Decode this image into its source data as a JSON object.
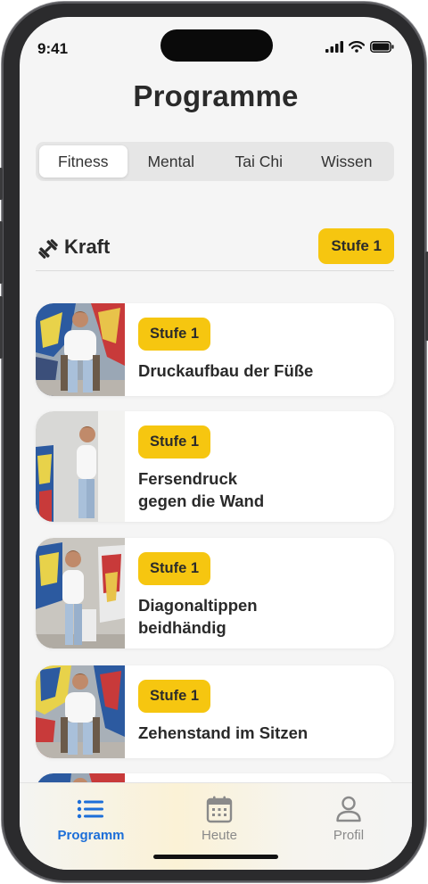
{
  "status_bar": {
    "time": "9:41"
  },
  "header": {
    "title": "Programme"
  },
  "tabs": [
    {
      "label": "Fitness",
      "active": true
    },
    {
      "label": "Mental",
      "active": false
    },
    {
      "label": "Tai Chi",
      "active": false
    },
    {
      "label": "Wissen",
      "active": false
    }
  ],
  "section": {
    "title": "Kraft",
    "icon": "dumbbell-icon",
    "level": "Stufe 1"
  },
  "exercises": [
    {
      "level": "Stufe 1",
      "title": "Druckaufbau der Füße"
    },
    {
      "level": "Stufe 1",
      "title": "Fersendruck\ngegen die Wand"
    },
    {
      "level": "Stufe 1",
      "title": "Diagonaltippen\nbeidhändig"
    },
    {
      "level": "Stufe 1",
      "title": "Zehenstand im Sitzen"
    }
  ],
  "tab_bar": [
    {
      "label": "Programm",
      "icon": "list-icon",
      "active": true
    },
    {
      "label": "Heute",
      "icon": "calendar-icon",
      "active": false
    },
    {
      "label": "Profil",
      "icon": "person-icon",
      "active": false
    }
  ],
  "colors": {
    "accent_yellow": "#f6c610",
    "active_blue": "#1c6ed8",
    "background": "#f5f5f5",
    "text": "#2a2a2a"
  }
}
